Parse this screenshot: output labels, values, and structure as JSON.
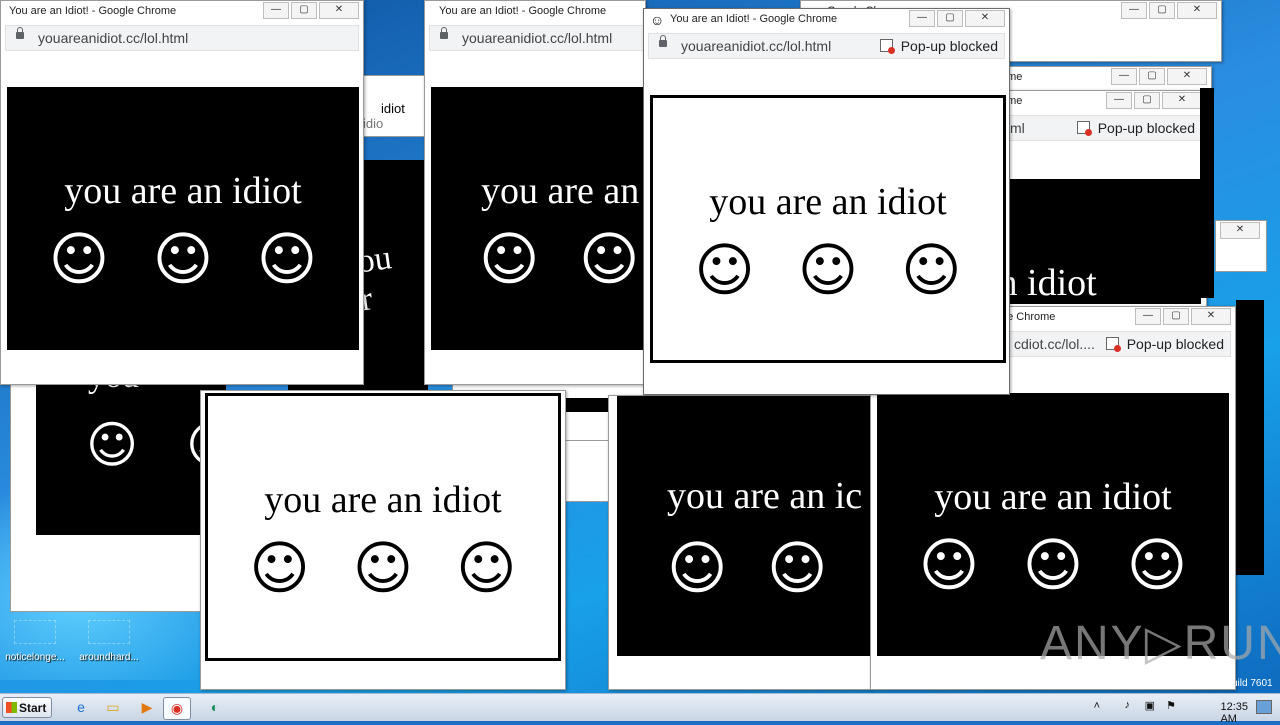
{
  "window_title": "You are an Idiot! - Google Chrome",
  "window_title_partial": "Google Chrome",
  "window_title_frag_a": "ee Chrome",
  "window_title_frag_b": "ome",
  "url": "youareanidiot.cc/lol.html",
  "url_partial": "ml",
  "url_partial2": "cdiot.cc/lol....",
  "popup_blocked": "Pop-up blocked",
  "phrase": "you are an idiot",
  "phrase_cut1": "you are an",
  "phrase_cut2": "you are an ic",
  "phrase_cut3": "e an idiot",
  "phrase_cut4": "you",
  "bg_frag1": "idiot",
  "bg_frag2": "idio",
  "bg_frag3": "you ar",
  "face": "☺",
  "desktop_icons": [
    "noticelonge...",
    "aroundhard..."
  ],
  "taskbar": {
    "start": "Start",
    "time": "12:35 AM"
  },
  "watermark": "ANY▷RUN",
  "build_text": "uild 7601",
  "window_buttons": {
    "minimize": "—",
    "maximize": "▢",
    "close": "✕"
  }
}
